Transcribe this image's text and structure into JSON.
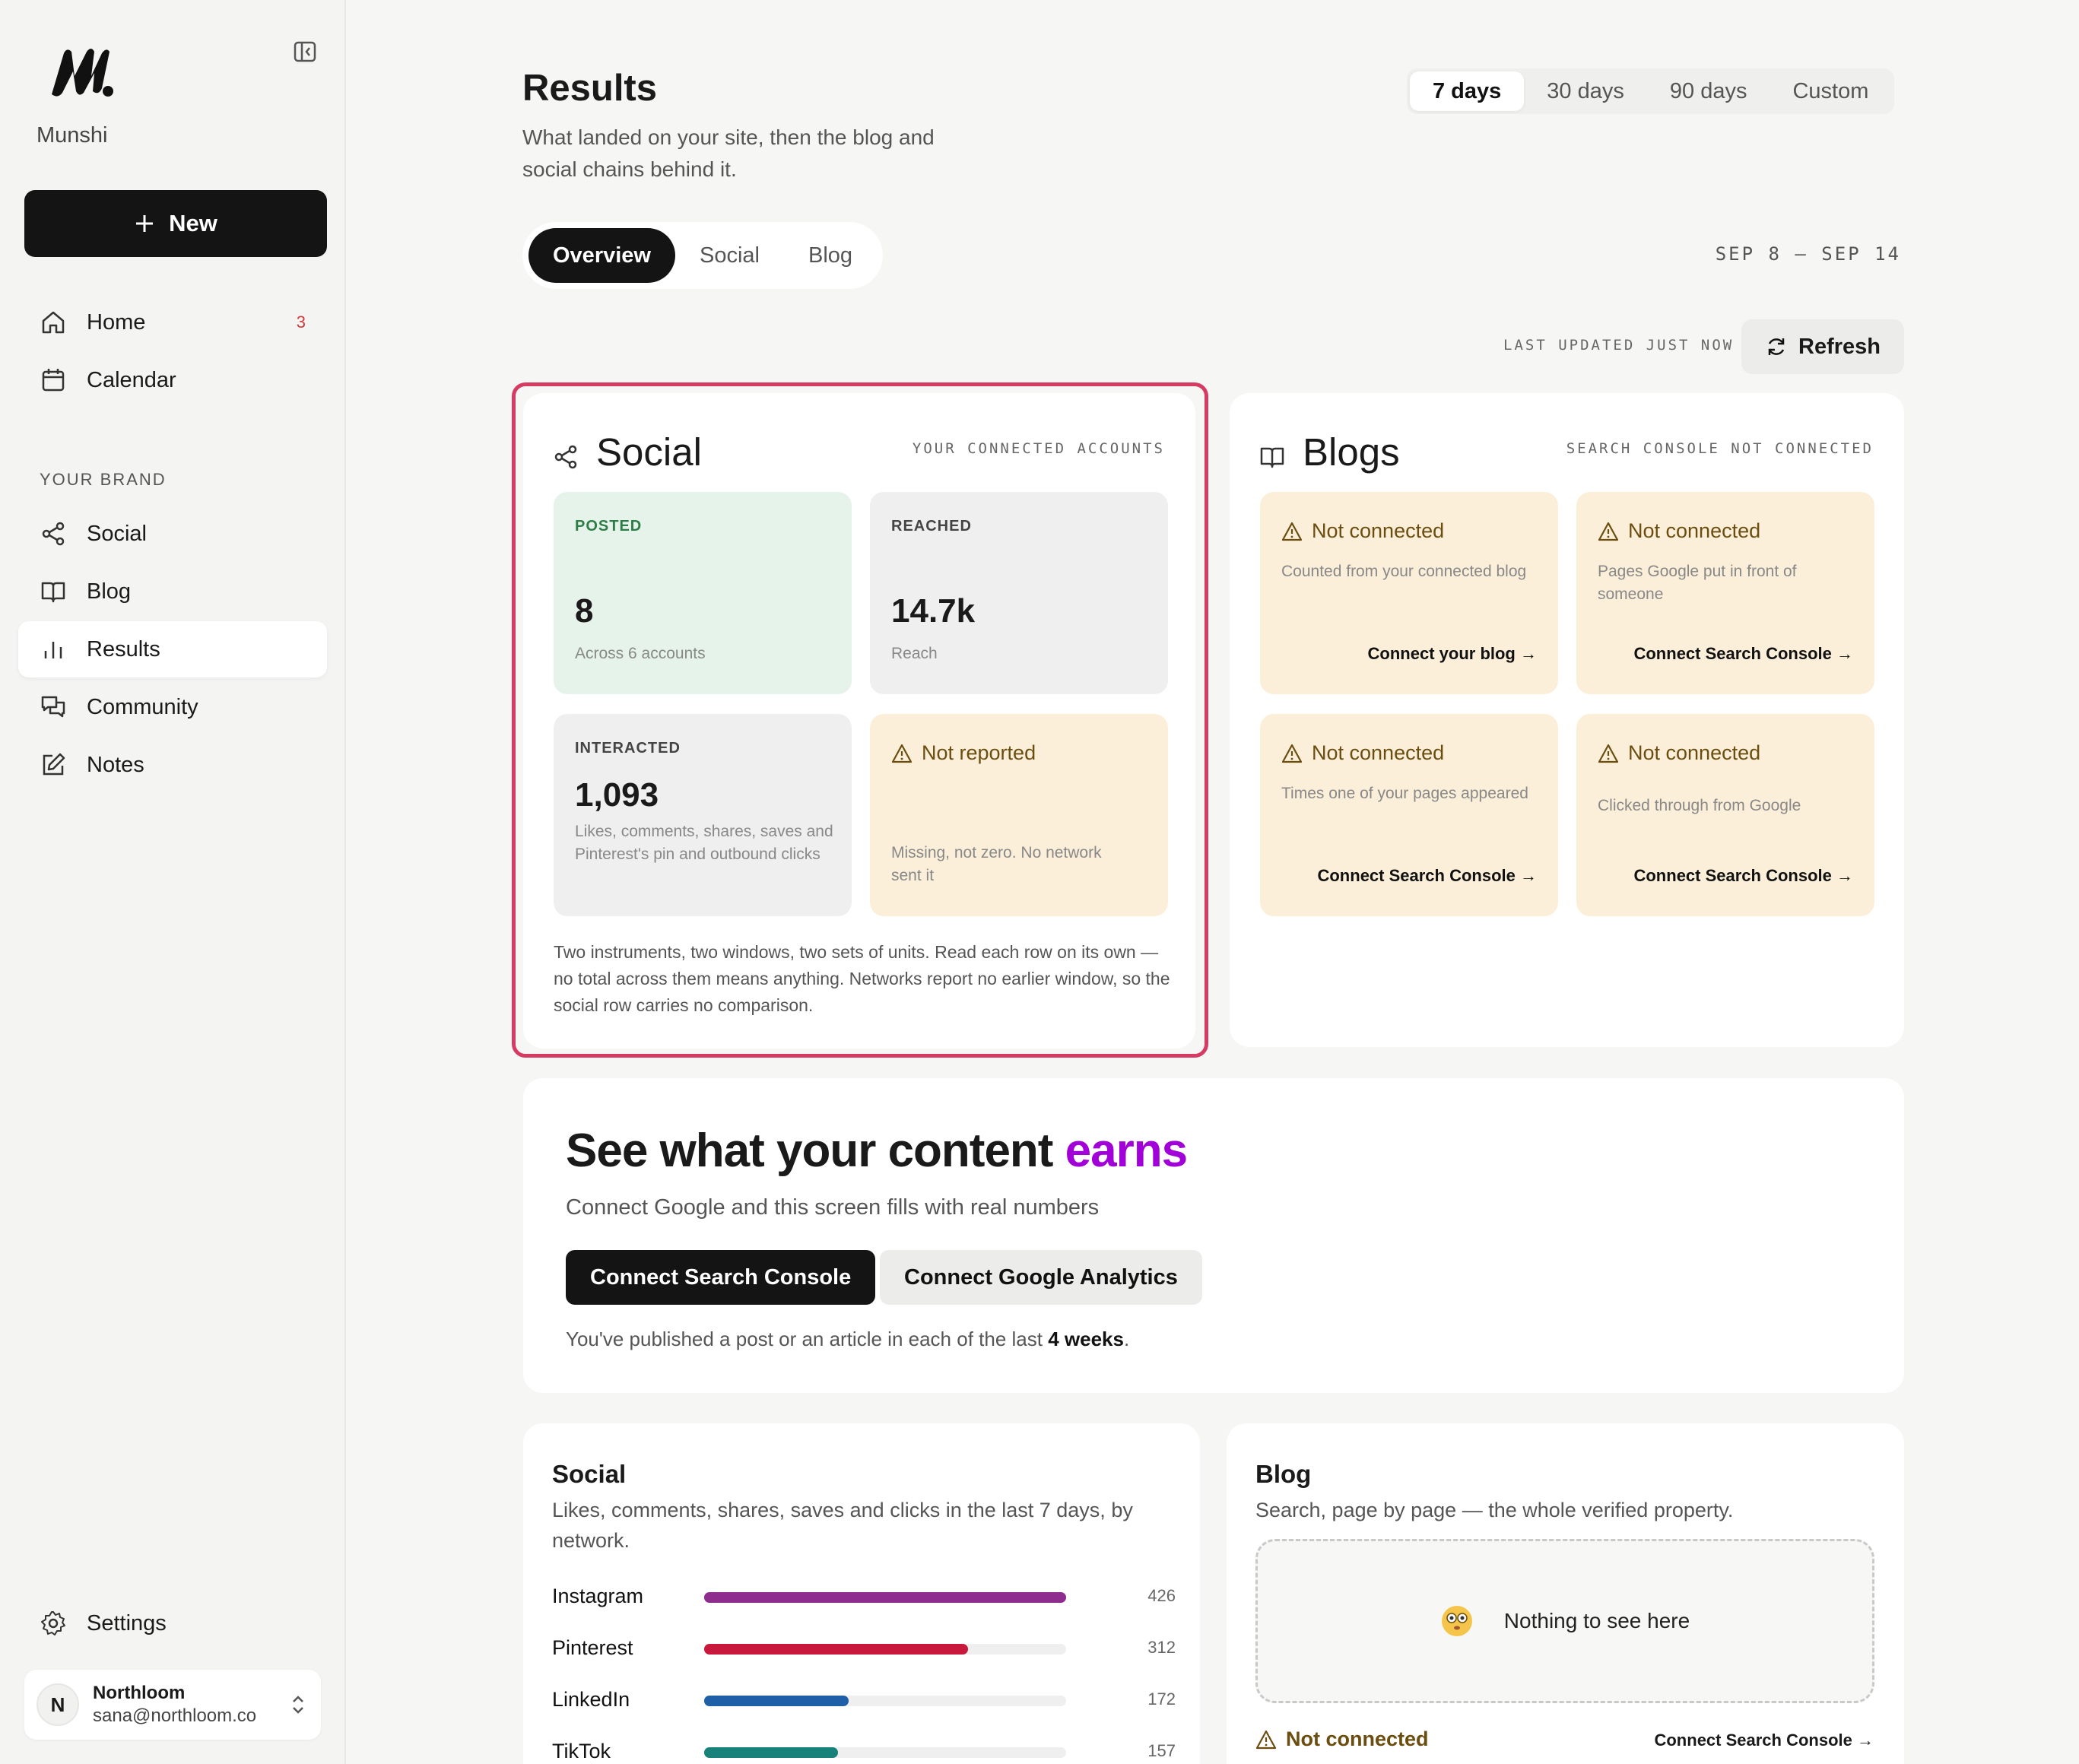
{
  "app": {
    "brand": "Munshi",
    "new_label": "New"
  },
  "sidebar": {
    "items": [
      {
        "label": "Home",
        "badge": "3"
      },
      {
        "label": "Calendar"
      }
    ],
    "section_label": "YOUR BRAND",
    "brand_items": [
      {
        "label": "Social"
      },
      {
        "label": "Blog"
      },
      {
        "label": "Results",
        "active": true
      },
      {
        "label": "Community"
      },
      {
        "label": "Notes"
      }
    ],
    "settings_label": "Settings",
    "account": {
      "initial": "N",
      "name": "Northloom",
      "email": "sana@northloom.co"
    }
  },
  "header": {
    "title": "Results",
    "subtitle": "What landed on your site, then the blog and social chains behind it.",
    "ranges": [
      "7 days",
      "30 days",
      "90 days",
      "Custom"
    ],
    "active_range": "7 days",
    "tabs": [
      "Overview",
      "Social",
      "Blog"
    ],
    "active_tab": "Overview",
    "date_range": "SEP 8 – SEP 14",
    "last_updated": "LAST UPDATED JUST NOW",
    "refresh_label": "Refresh"
  },
  "social_card": {
    "title": "Social",
    "meta": "YOUR CONNECTED ACCOUNTS",
    "posted": {
      "label": "POSTED",
      "value": "8",
      "note": "Across 6 accounts"
    },
    "reached": {
      "label": "REACHED",
      "value": "14.7k",
      "note": "Reach"
    },
    "interacted": {
      "label": "INTERACTED",
      "value": "1,093",
      "note": "Likes, comments, shares, saves and Pinterest's pin and outbound clicks"
    },
    "not_reported": {
      "label": "Not reported",
      "note": "Missing, not zero. No network sent it"
    },
    "explainer": "Two instruments, two windows, two sets of units. Read each row on its own — no total across them means anything. Networks report no earlier window, so the social row carries no comparison."
  },
  "blogs_card": {
    "title": "Blogs",
    "meta": "SEARCH CONSOLE NOT CONNECTED",
    "tiles": [
      {
        "status": "Not connected",
        "note": "Counted from your connected blog",
        "link": "Connect your blog →"
      },
      {
        "status": "Not connected",
        "note": "Pages Google put in front of someone",
        "link": "Connect Search Console →"
      },
      {
        "status": "Not connected",
        "note": "Times one of your pages appeared",
        "link": "Connect Search Console →"
      },
      {
        "status": "Not connected",
        "note": "Clicked through from Google",
        "link": "Connect Search Console →"
      }
    ]
  },
  "earn_card": {
    "title_start": "See what your content ",
    "title_accent": "earns",
    "subtitle": "Connect Google and this screen fills with real numbers",
    "primary_btn": "Connect Search Console",
    "secondary_btn": "Connect Google Analytics",
    "streak_prefix": "You've published a post or an article in each of the last ",
    "streak_bold": "4 weeks",
    "streak_suffix": "."
  },
  "social_breakdown": {
    "title": "Social",
    "desc": "Likes, comments, shares, saves and clicks in the last 7 days, by network.",
    "rows": [
      {
        "name": "Instagram",
        "value": 426,
        "fraction": 1.0,
        "color": "#8e2d8e"
      },
      {
        "name": "Pinterest",
        "value": 312,
        "fraction": 0.73,
        "color": "#c8193c"
      },
      {
        "name": "LinkedIn",
        "value": 172,
        "fraction": 0.4,
        "color": "#1f5fa8"
      },
      {
        "name": "TikTok",
        "value": 157,
        "fraction": 0.37,
        "color": "#17827a"
      }
    ]
  },
  "blog_breakdown": {
    "title": "Blog",
    "desc": "Search, page by page — the whole verified property.",
    "empty_text": "Nothing to see here",
    "status": "Not connected",
    "link": "Connect Search Console →"
  },
  "colors": {
    "accent": "#a100d8",
    "highlight": "#d63b63",
    "warn_bg": "#fcefd9",
    "posted_bg": "#e6f3ea"
  }
}
